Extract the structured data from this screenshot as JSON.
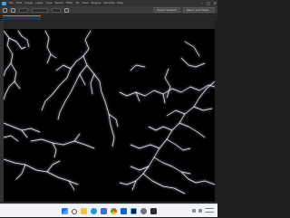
{
  "menu": [
    "File",
    "Edit",
    "Image",
    "Layer",
    "Type",
    "Select",
    "Filter",
    "3D",
    "View",
    "Plugins",
    "Window",
    "Help"
  ],
  "toolbar": {
    "select_subject_label": "Select Subject",
    "select_mask_label": "Select and Mask..."
  },
  "colors": {
    "accent": "#31a8ff",
    "canvas_bg": "#000000",
    "chrome_dark": "#2b2b2b",
    "taskbar_bg": "#f1f3f8"
  },
  "taskbar": {
    "icons": [
      "windows-start-icon",
      "search-icon",
      "file-explorer-icon",
      "edge-icon",
      "store-icon",
      "chrome-icon",
      "mail-icon",
      "photoshop-icon",
      "settings-icon",
      "terminal-icon"
    ]
  }
}
